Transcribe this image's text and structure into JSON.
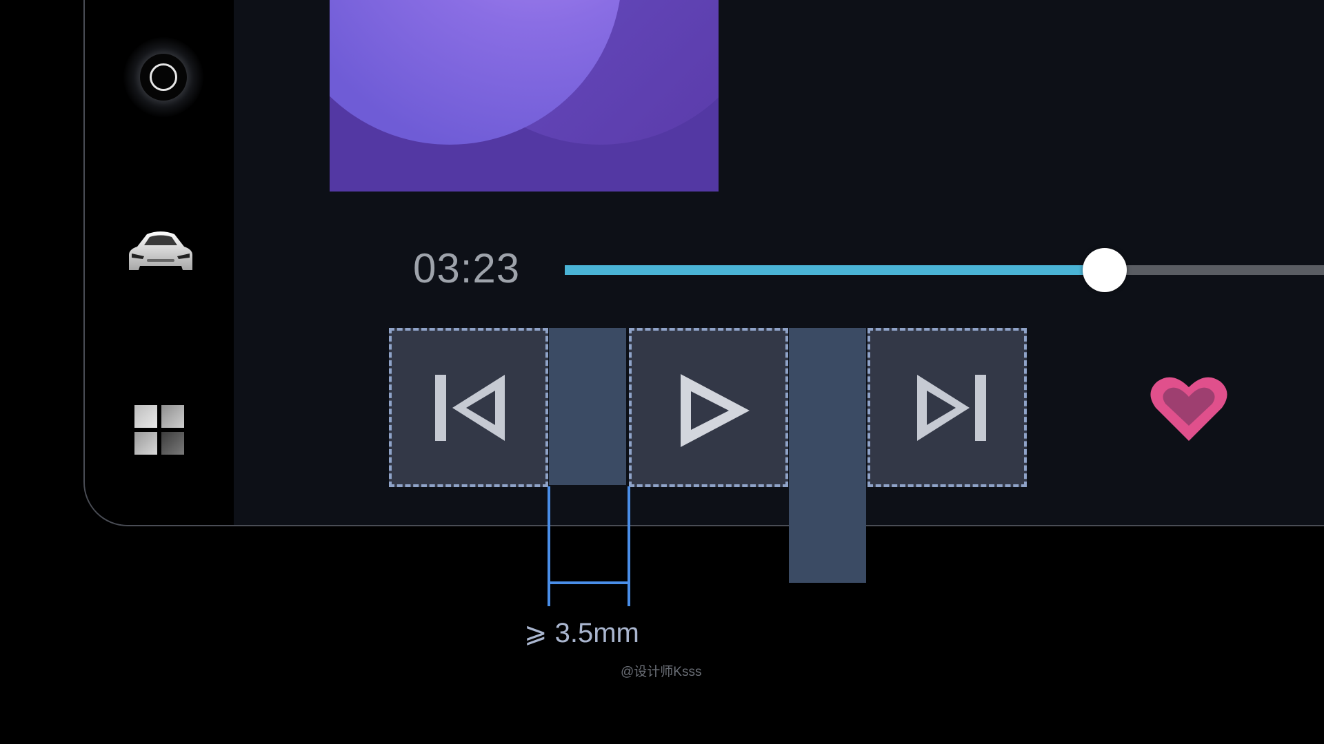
{
  "sidebar": {
    "items": [
      {
        "name": "home",
        "icon": "ring-icon"
      },
      {
        "name": "vehicle",
        "icon": "car-icon"
      },
      {
        "name": "apps",
        "icon": "grid-icon"
      }
    ]
  },
  "player": {
    "elapsed": "03:23",
    "progress_fraction": 0.711,
    "controls": [
      {
        "name": "previous",
        "icon": "skip-previous-icon"
      },
      {
        "name": "play",
        "icon": "play-icon"
      },
      {
        "name": "next",
        "icon": "skip-next-icon"
      }
    ],
    "favorite_icon": "heart-icon",
    "accent_color": "#4ab4d6",
    "favorite_color": "#e0508c"
  },
  "annotation": {
    "spacing_label": "⩾ 3.5mm",
    "measure_color": "#4a8ee8",
    "target_outline_color": "#8fa3c8"
  },
  "watermark": "@设计师Ksss"
}
